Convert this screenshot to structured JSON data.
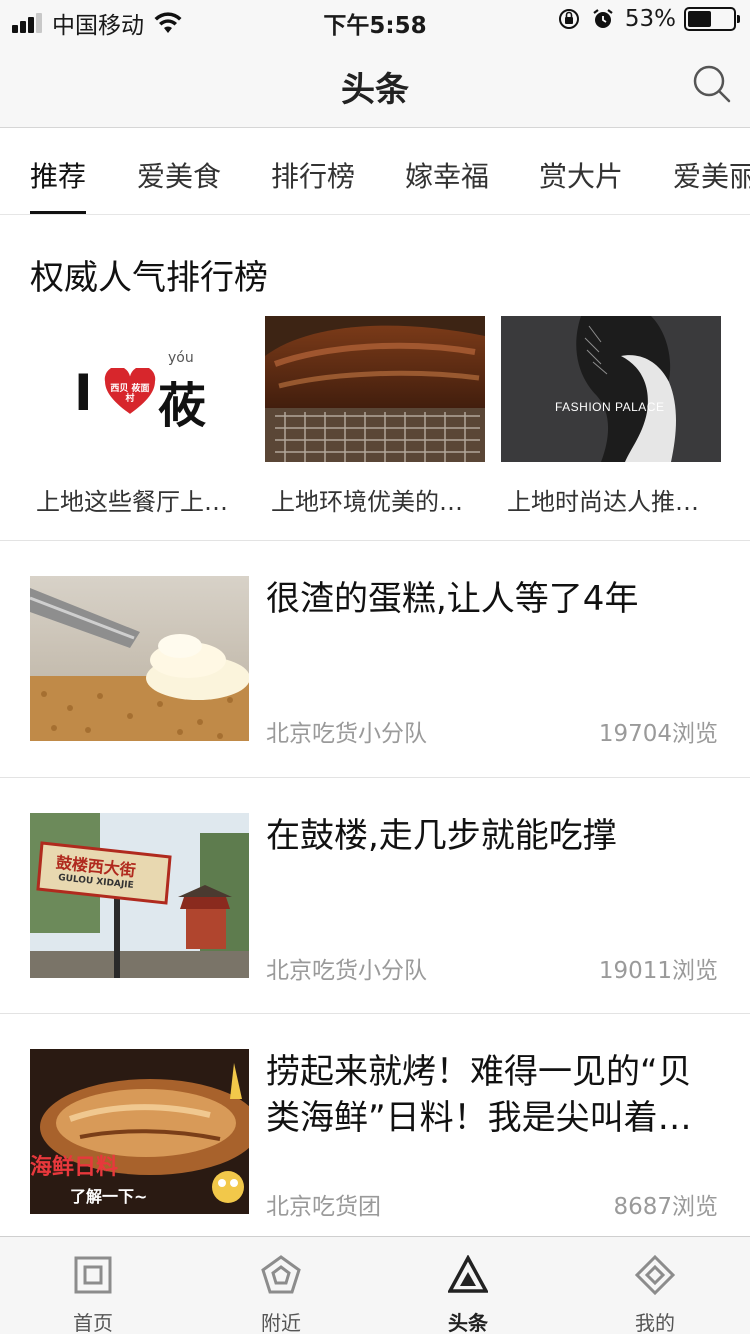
{
  "status_bar": {
    "carrier": "中国移动",
    "time": "下午5:58",
    "battery": "53%",
    "battery_level": 0.53,
    "icons": [
      "signal-icon",
      "wifi-icon",
      "orientation-lock-icon",
      "alarm-icon",
      "battery-icon"
    ]
  },
  "nav": {
    "title": "头条",
    "search_icon": "search-icon"
  },
  "tabs": [
    {
      "label": "推荐",
      "active": true
    },
    {
      "label": "爱美食",
      "active": false
    },
    {
      "label": "排行榜",
      "active": false
    },
    {
      "label": "嫁幸福",
      "active": false
    },
    {
      "label": "赏大片",
      "active": false
    },
    {
      "label": "爱美丽",
      "active": false
    }
  ],
  "ranking": {
    "title": "权威人气排行榜",
    "cards": [
      {
        "caption": "上地这些餐厅上…",
        "logo_text": "I",
        "logo_char": "莜",
        "logo_pinyin": "yóu",
        "logo_heart_text": "西贝 莜面村"
      },
      {
        "caption": "上地环境优美的…"
      },
      {
        "caption": "上地时尚达人推…",
        "image_text": "FASHION PALACE"
      }
    ]
  },
  "articles": [
    {
      "title": "很渣的蛋糕,让人等了4年",
      "source": "北京吃货小分队",
      "views": "19704浏览"
    },
    {
      "title": "在鼓楼,走几步就能吃撑",
      "source": "北京吃货小分队",
      "views": "19011浏览",
      "sign_cn": "鼓楼西大街",
      "sign_pinyin": "GULOU XIDAJIE"
    },
    {
      "title": "捞起来就烤！难得一见的“贝类海鲜”日料！我是尖叫着…",
      "source": "北京吃货团",
      "views": "8687浏览",
      "overlay_1": "海鲜日料",
      "overlay_2": "了解一下~"
    }
  ],
  "tabbar": [
    {
      "label": "首页",
      "icon": "home-square-icon",
      "active": false
    },
    {
      "label": "附近",
      "icon": "nearby-pentagon-icon",
      "active": false
    },
    {
      "label": "头条",
      "icon": "headline-triangle-icon",
      "active": true
    },
    {
      "label": "我的",
      "icon": "profile-diamond-icon",
      "active": false
    }
  ]
}
